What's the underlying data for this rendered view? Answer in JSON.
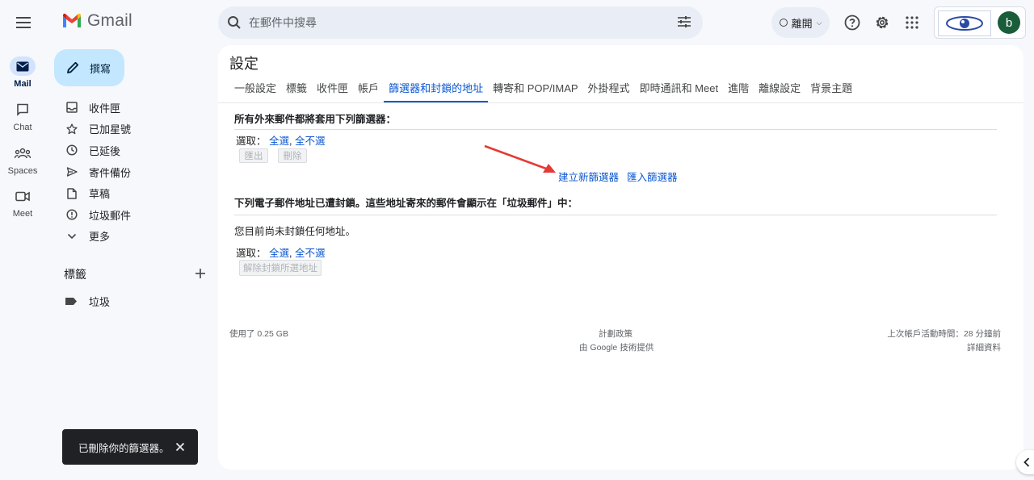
{
  "app": {
    "name": "Gmail"
  },
  "search": {
    "placeholder": "在郵件中搜尋"
  },
  "status": {
    "label": "離開"
  },
  "account": {
    "avatar_letter": "b"
  },
  "rail": [
    {
      "label": "Mail",
      "icon": "mail-icon",
      "active": true
    },
    {
      "label": "Chat",
      "icon": "chat-icon"
    },
    {
      "label": "Spaces",
      "icon": "spaces-icon"
    },
    {
      "label": "Meet",
      "icon": "meet-icon"
    }
  ],
  "compose": {
    "label": "撰寫"
  },
  "nav": [
    {
      "label": "收件匣",
      "icon": "inbox-icon"
    },
    {
      "label": "已加星號",
      "icon": "star-icon"
    },
    {
      "label": "已延後",
      "icon": "clock-icon"
    },
    {
      "label": "寄件備份",
      "icon": "send-icon"
    },
    {
      "label": "草稿",
      "icon": "draft-icon"
    },
    {
      "label": "垃圾郵件",
      "icon": "spam-icon"
    },
    {
      "label": "更多",
      "icon": "chevron-down-icon"
    }
  ],
  "labels": {
    "header": "標籤",
    "items": [
      {
        "label": "垃圾",
        "icon": "label-icon"
      }
    ]
  },
  "settings": {
    "title": "設定",
    "tabs": [
      "一般設定",
      "標籤",
      "收件匣",
      "帳戶",
      "篩選器和封鎖的地址",
      "轉寄和 POP/IMAP",
      "外掛程式",
      "即時通訊和 Meet",
      "進階",
      "離線設定",
      "背景主題"
    ],
    "active_tab_index": 4,
    "filters": {
      "title": "所有外來郵件都將套用下列篩選器：",
      "select_label": "選取：",
      "select_all": "全選",
      "select_none": "全不選",
      "export_button": "匯出",
      "delete_button": "刪除",
      "create_link": "建立新篩選器",
      "import_link": "匯入篩選器"
    },
    "blocked": {
      "title": "下列電子郵件地址已遭封鎖。這些地址寄來的郵件會顯示在「垃圾郵件」中：",
      "empty_text": "您目前尚未封鎖任何地址。",
      "select_label": "選取：",
      "select_all": "全選",
      "select_none": "全不選",
      "unblock_button": "解除封鎖所選地址"
    }
  },
  "footer": {
    "storage": "使用了 0.25 GB",
    "policy": "計劃政策",
    "powered": "由 Google 技術提供",
    "last_activity": "上次帳戶活動時間：28 分鐘前",
    "details": "詳細資料"
  },
  "toast": {
    "message": "已刪除你的篩選器。"
  },
  "colors": {
    "accent": "#0b57d0",
    "compose_bg": "#c2e7ff",
    "annotation_arrow": "#e53935"
  }
}
